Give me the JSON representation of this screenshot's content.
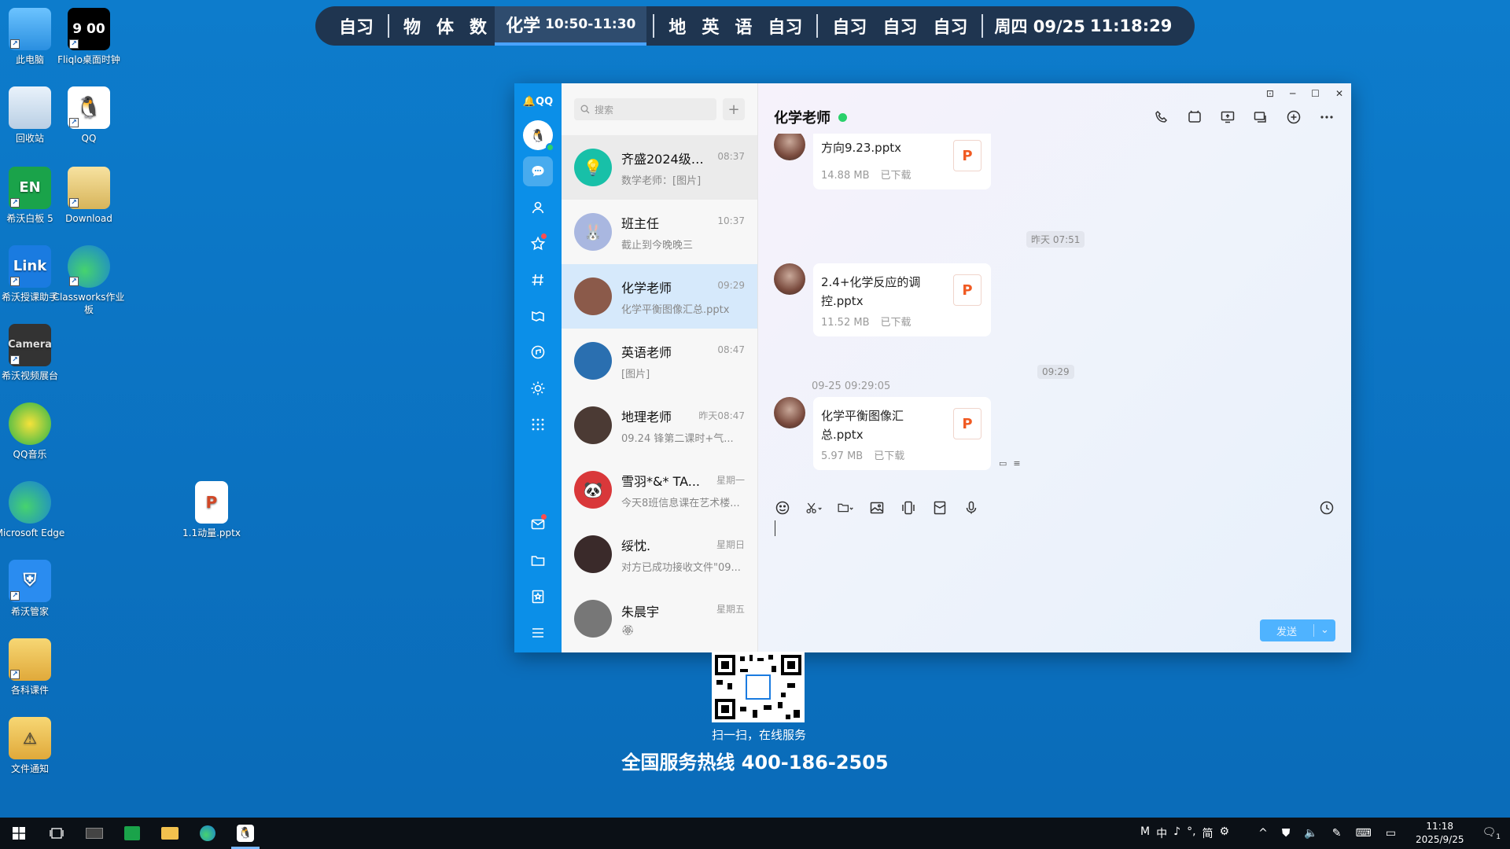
{
  "desktop_icons": [
    {
      "label": "此电脑"
    },
    {
      "label": "Fliqlo桌面时钟",
      "glyph": "9 00"
    },
    {
      "label": "回收站"
    },
    {
      "label": "QQ"
    },
    {
      "label": "希沃白板 5",
      "glyph": "EN"
    },
    {
      "label": "Download"
    },
    {
      "label": "希沃授课助手",
      "glyph": "Link"
    },
    {
      "label": "Classworks作业板"
    },
    {
      "label": "希沃视频展台",
      "glyph": "Camera"
    },
    {
      "label": "QQ音乐"
    },
    {
      "label": "Microsoft Edge"
    },
    {
      "label": "希沃管家"
    },
    {
      "label": "各科课件"
    },
    {
      "label": "文件通知"
    },
    {
      "label": "1.1动量.pptx"
    }
  ],
  "schedule": {
    "before": [
      "自习"
    ],
    "group1": [
      "物",
      "体",
      "数"
    ],
    "current": {
      "label": "化学",
      "time": "10:50-11:30"
    },
    "group2": [
      "地",
      "英",
      "语",
      "自习"
    ],
    "group3": [
      "自习",
      "自习",
      "自习"
    ],
    "day": "周四 09/25",
    "clock": "11:18:29"
  },
  "qq": {
    "logo": "QQ",
    "search_placeholder": "搜索",
    "conversations": [
      {
        "name": "齐盛2024级8...",
        "time": "08:37",
        "preview": "数学老师：[图片]",
        "avatar_color": "#18c0a8",
        "avatar_glyph": "💡"
      },
      {
        "name": "班主任",
        "time": "10:37",
        "preview": "截止到今晚晚三",
        "avatar_color": "#a9b7e0",
        "avatar_glyph": "🐰"
      },
      {
        "name": "化学老师",
        "time": "09:29",
        "preview": "化学平衡图像汇总.pptx",
        "avatar_color": "#8b5a4a",
        "avatar_glyph": ""
      },
      {
        "name": "英语老师",
        "time": "08:47",
        "preview": "[图片]",
        "avatar_color": "#2a6fb0",
        "avatar_glyph": ""
      },
      {
        "name": "地理老师",
        "time": "昨天08:47",
        "preview": "09.24 锋第二课时+气...",
        "avatar_color": "#4b3a34",
        "avatar_glyph": ""
      },
      {
        "name": "雪羽*&* TA...",
        "time": "星期一",
        "preview": "今天8班信息课在艺术楼...",
        "avatar_color": "#d9383a",
        "avatar_glyph": "🐼"
      },
      {
        "name": "绥忱.",
        "time": "星期日",
        "preview": "对方已成功接收文件\"09...",
        "avatar_color": "#3a2a2a",
        "avatar_glyph": ""
      },
      {
        "name": "朱晨宇",
        "time": "星期五",
        "preview": "🏵",
        "avatar_color": "#777777",
        "avatar_glyph": ""
      }
    ],
    "chat": {
      "title": "化学老师",
      "messages": [
        {
          "file": "方向9.23.pptx",
          "size": "14.88 MB",
          "status": "已下载"
        },
        {
          "file": "2.4+化学反应的调控.pptx",
          "size": "11.52 MB",
          "status": "已下载"
        },
        {
          "file": "化学平衡图像汇总.pptx",
          "size": "5.97 MB",
          "status": "已下载"
        }
      ],
      "stamps": [
        "昨天 07:51",
        "09:29"
      ],
      "sender_time": "09-25 09:29:05",
      "send_label": "发送"
    }
  },
  "qr_caption": "扫一扫，在线服务",
  "hotline": "全国服务热线 400-186-2505",
  "taskbar": {
    "ime": [
      "M",
      "中",
      "♪",
      "°,",
      "简",
      "⚙"
    ],
    "time": "11:18",
    "date": "2025/9/25",
    "notif_count": "1"
  },
  "colors": {
    "accent": "#0b8fe8",
    "desktop": "#0f78c8",
    "online": "#2ad16b",
    "ppt": "#f05a22"
  }
}
